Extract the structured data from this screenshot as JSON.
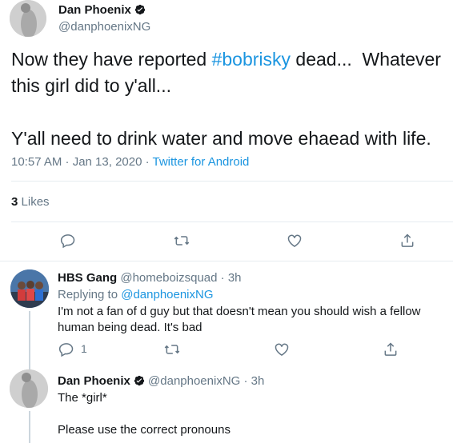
{
  "main_tweet": {
    "display_name": "Dan Phoenix",
    "handle": "@danphoenixNG",
    "text_before": "Now they have reported ",
    "hashtag": "#bobrisky",
    "text_after": " dead...  Whatever this girl did to y'all...\n\nY'all need to drink water and move ehaead with life.",
    "time": "10:57 AM · Jan 13, 2020 · ",
    "source": "Twitter for Android",
    "likes_count": "3",
    "likes_label": "Likes"
  },
  "reply_1": {
    "display_name": "HBS Gang",
    "handle_time": "@homeboizsquad · 3h",
    "replying_prefix": "Replying to ",
    "replying_to": "@danphoenixNG",
    "text": "I'm not a fan of d guy but that doesn't mean you should wish a fellow human being dead. It's bad",
    "reply_count": "1"
  },
  "reply_2": {
    "display_name": "Dan Phoenix",
    "handle_time": "@danphoenixNG · 3h",
    "text": "The *girl*\n\nPlease use the correct pronouns"
  },
  "icons": [
    "verified-icon",
    "reply-icon",
    "retweet-icon",
    "like-icon",
    "share-icon"
  ],
  "colors": {
    "link": "#1b95e0",
    "secondary": "#657786",
    "divider": "#e6ecf0",
    "text": "#14171a"
  }
}
